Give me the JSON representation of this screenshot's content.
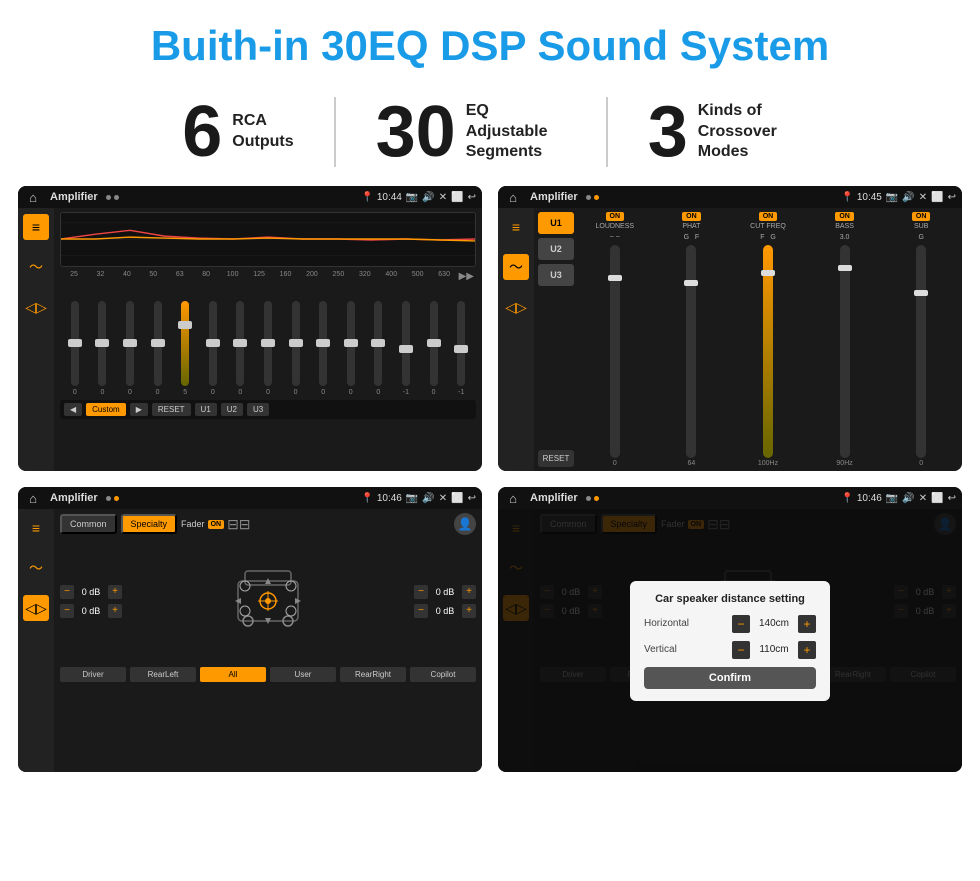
{
  "page": {
    "title": "Buith-in 30EQ DSP Sound System"
  },
  "stats": [
    {
      "number": "6",
      "label": "RCA\nOutputs"
    },
    {
      "number": "30",
      "label": "EQ Adjustable\nSegments"
    },
    {
      "number": "3",
      "label": "Kinds of\nCrossover Modes"
    }
  ],
  "screens": [
    {
      "id": "eq-screen",
      "title": "Amplifier",
      "time": "10:44",
      "type": "eq"
    },
    {
      "id": "amp-screen",
      "title": "Amplifier",
      "time": "10:45",
      "type": "amp"
    },
    {
      "id": "cross-screen",
      "title": "Amplifier",
      "time": "10:46",
      "type": "cross"
    },
    {
      "id": "dialog-screen",
      "title": "Amplifier",
      "time": "10:46",
      "type": "dialog"
    }
  ],
  "eq": {
    "frequencies": [
      "25",
      "32",
      "40",
      "50",
      "63",
      "80",
      "100",
      "125",
      "160",
      "200",
      "250",
      "320",
      "400",
      "500",
      "630"
    ],
    "values": [
      "0",
      "0",
      "0",
      "0",
      "5",
      "0",
      "0",
      "0",
      "0",
      "0",
      "0",
      "0",
      "-1",
      "0",
      "-1"
    ],
    "presets": [
      "Custom",
      "RESET",
      "U1",
      "U2",
      "U3"
    ]
  },
  "amp": {
    "presets": [
      "U1",
      "U2",
      "U3"
    ],
    "channels": [
      "LOUDNESS",
      "PHAT",
      "CUT FREQ",
      "BASS",
      "SUB"
    ],
    "reset": "RESET"
  },
  "cross": {
    "tabs": [
      "Common",
      "Specialty"
    ],
    "fader": "Fader",
    "faderOn": "ON",
    "dbValues": [
      "0 dB",
      "0 dB",
      "0 dB",
      "0 dB"
    ],
    "bottomBtns": [
      "Driver",
      "RearLeft",
      "All",
      "User",
      "RearRight",
      "Copilot"
    ]
  },
  "dialog": {
    "title": "Car speaker distance setting",
    "horizontal": {
      "label": "Horizontal",
      "value": "140cm"
    },
    "vertical": {
      "label": "Vertical",
      "value": "110cm"
    },
    "confirm": "Confirm"
  }
}
